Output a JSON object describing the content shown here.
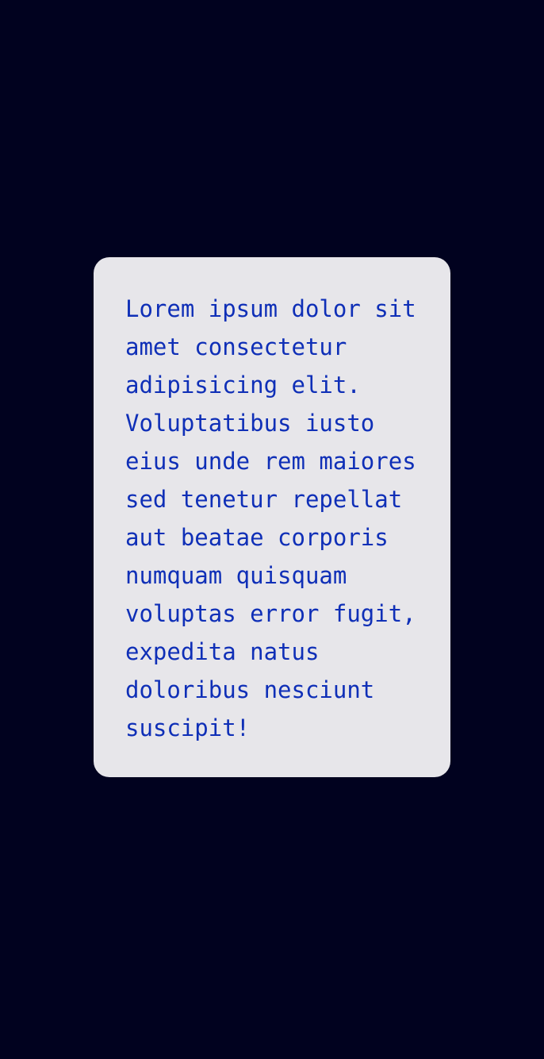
{
  "card": {
    "text": "Lorem ipsum dolor sit amet consectetur adipisicing elit. Voluptatibus iusto eius unde rem maiores sed tenetur repellat aut beatae corporis numquam quisquam voluptas error fugit, expedita natus doloribus nesciunt suscipit!"
  },
  "colors": {
    "background": "#01021f",
    "card_background": "#e7e6ea",
    "text": "#0f2fb7"
  }
}
